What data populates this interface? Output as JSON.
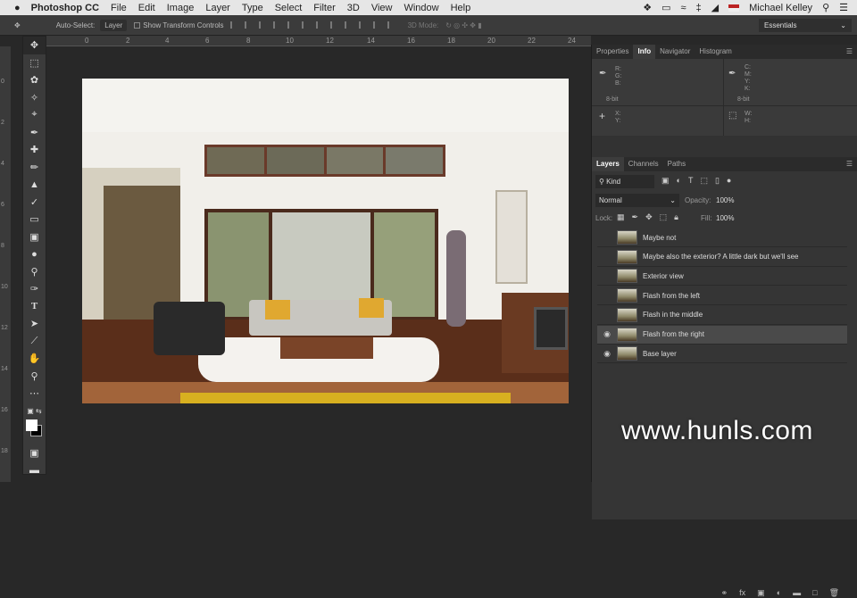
{
  "menubar": {
    "app": "Photoshop CC",
    "items": [
      "File",
      "Edit",
      "Image",
      "Layer",
      "Type",
      "Select",
      "Filter",
      "3D",
      "View",
      "Window",
      "Help"
    ],
    "user": "Michael Kelley"
  },
  "options": {
    "auto_select_label": "Auto-Select:",
    "auto_select_value": "Layer",
    "transform_label": "Show Transform Controls",
    "mode_3d": "3D Mode:",
    "workspace": "Essentials"
  },
  "ruler": {
    "h": [
      "0",
      "2",
      "4",
      "6",
      "8",
      "10",
      "12",
      "14",
      "16",
      "18",
      "20",
      "22",
      "24"
    ],
    "v": [
      "0",
      "2",
      "4",
      "6",
      "8",
      "10",
      "12",
      "14",
      "16",
      "18"
    ]
  },
  "info_panel": {
    "tabs": [
      "Properties",
      "Info",
      "Navigator",
      "Histogram"
    ],
    "active": "Info",
    "rgb": "R:\nG:\nB:",
    "cmyk": "C:\nM:\nY:\nK:",
    "bit1": "8-bit",
    "bit2": "8-bit",
    "xy": "X:\nY:",
    "wh": "W:\nH:"
  },
  "layers_panel": {
    "tabs": [
      "Layers",
      "Channels",
      "Paths"
    ],
    "filter": "Kind",
    "blend": "Normal",
    "opacity_label": "Opacity:",
    "opacity": "100%",
    "lock_label": "Lock:",
    "fill_label": "Fill:",
    "fill": "100%",
    "layers": [
      {
        "name": "Maybe not",
        "visible": false
      },
      {
        "name": "Maybe also the exterior? A little dark but we'll see",
        "visible": false
      },
      {
        "name": "Exterior view",
        "visible": false
      },
      {
        "name": "Flash from the left",
        "visible": false
      },
      {
        "name": "Flash in the middle",
        "visible": false
      },
      {
        "name": "Flash from the right",
        "visible": false,
        "selected": true
      },
      {
        "name": "Base layer",
        "visible": true
      }
    ]
  },
  "watermark": "www.hunls.com"
}
